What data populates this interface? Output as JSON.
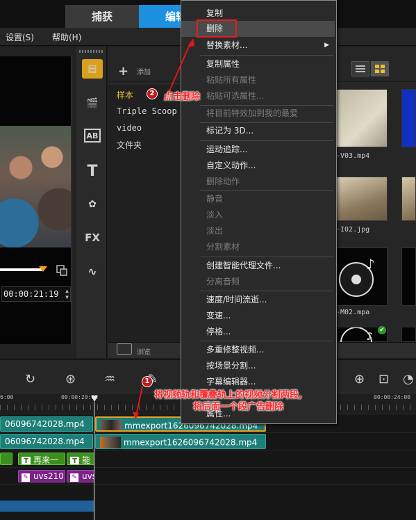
{
  "tabs": {
    "capture": "捕获",
    "edit": "编辑"
  },
  "menubar": {
    "settings": "设置(S)",
    "help": "帮助(H)"
  },
  "player": {
    "timecode": "00:00:21:19"
  },
  "library": {
    "add_label": "添加",
    "browse_label": "浏览",
    "folders": [
      "样本",
      "Triple Scoop I",
      "video",
      "文件夹"
    ],
    "thumbs": [
      "-V03.mp4",
      "-I02.jpg",
      "-M02.mpa"
    ]
  },
  "timeline": {
    "ruler": [
      "6:00",
      "00:00:20:00",
      "00:00:24:00"
    ],
    "track1": {
      "left": "06096742028.mp4",
      "right": "mmexport1626096742028.mp4"
    },
    "track2": {
      "left": "06096742028.mp4",
      "right": "mmexport1626096742028.mp4"
    },
    "titles": [
      "再来一",
      "能"
    ],
    "fx": [
      "uvs210",
      "uvs"
    ]
  },
  "context_menu": {
    "items": [
      {
        "label": "复制",
        "disabled": false
      },
      {
        "label": "删除",
        "disabled": false,
        "highlighted": true
      },
      {
        "label": "替换素材...",
        "disabled": false,
        "submenu": true
      },
      {
        "label": "复制属性",
        "disabled": false
      },
      {
        "label": "粘贴所有属性",
        "disabled": true
      },
      {
        "label": "粘贴可选属性...",
        "disabled": true
      },
      {
        "label": "将目前特效加到我的最爱",
        "disabled": true
      },
      {
        "label": "标记为 3D...",
        "disabled": false
      },
      {
        "label": "运动追踪...",
        "disabled": false
      },
      {
        "label": "自定义动作...",
        "disabled": false
      },
      {
        "label": "删除动作",
        "disabled": true
      },
      {
        "label": "静音",
        "disabled": true
      },
      {
        "label": "淡入",
        "disabled": true
      },
      {
        "label": "淡出",
        "disabled": true
      },
      {
        "label": "分割素材",
        "disabled": true
      },
      {
        "label": "创建智能代理文件...",
        "disabled": false
      },
      {
        "label": "分离音频",
        "disabled": true
      },
      {
        "label": "速度/时间流逝...",
        "disabled": false
      },
      {
        "label": "变速...",
        "disabled": false
      },
      {
        "label": "停格...",
        "disabled": false
      },
      {
        "label": "多重修整视频...",
        "disabled": false
      },
      {
        "label": "按场景分割...",
        "disabled": false
      },
      {
        "label": "字幕编辑器...",
        "disabled": false
      },
      {
        "label": "属性...",
        "disabled": false
      }
    ]
  },
  "annotations": {
    "step1_num": "1",
    "step1_line1": "将视频轨和覆叠轨上的视频分割两段,",
    "step1_line2": "将后面一个段广告删除",
    "step2_num": "2",
    "step2_text": "点击删除",
    "color": "#e01818"
  }
}
